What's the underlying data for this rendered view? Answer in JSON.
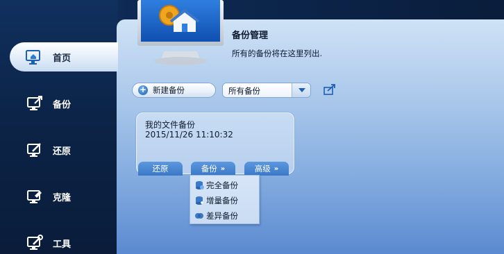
{
  "header": {
    "title": "备份管理",
    "subtitle": "所有的备份将在这里列出."
  },
  "sidebar": {
    "items": [
      {
        "label": "首页",
        "icon": "home-monitor-icon",
        "active": true
      },
      {
        "label": "备份",
        "icon": "backup-monitor-icon",
        "active": false
      },
      {
        "label": "还原",
        "icon": "restore-monitor-icon",
        "active": false
      },
      {
        "label": "克隆",
        "icon": "clone-monitor-icon",
        "active": false
      },
      {
        "label": "工具",
        "icon": "tools-monitor-icon",
        "active": false
      }
    ]
  },
  "toolbar": {
    "new_backup_label": "新建备份",
    "filter_value": "所有备份"
  },
  "backup_card": {
    "name": "我的文件备份",
    "time": "2015/11/26 11:10:32",
    "restore_label": "还原",
    "backup_label": "备份",
    "advanced_label": "高级"
  },
  "backup_menu": {
    "items": [
      {
        "label": "完全备份",
        "icon": "full-backup-icon"
      },
      {
        "label": "增量备份",
        "icon": "incremental-backup-icon"
      },
      {
        "label": "差异备份",
        "icon": "differential-backup-icon"
      }
    ]
  },
  "colors": {
    "accent": "#3a78c8",
    "sidebar_bg": "#0c2448",
    "panel_top": "#cfe2f6",
    "panel_bottom": "#5b8ad1"
  }
}
